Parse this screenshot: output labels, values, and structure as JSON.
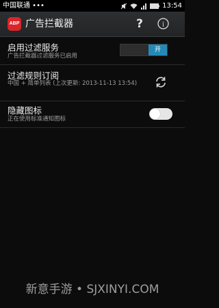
{
  "status_bar": {
    "carrier": "中国联通 ••• ",
    "time": "13:54"
  },
  "app": {
    "icon_text": "ABP",
    "title": "广告拦截器",
    "help_label": "?",
    "info_label": "i"
  },
  "settings": {
    "filtering": {
      "title": "启用过滤服务",
      "summary": "广告拦截器过滤服务已启用",
      "toggle_label": "开",
      "enabled": true
    },
    "subscription": {
      "title": "过滤规则订阅",
      "summary": "中国 + 简单列表 (上次更新: 2013-11-13 13:54)"
    },
    "hide_icon": {
      "title": "隐藏图标",
      "summary": "正在使用标准通知图标",
      "enabled": false
    }
  },
  "watermark": "新意手游 • SJXINYI.COM",
  "colors": {
    "accent": "#2489b7",
    "app_icon": "#d8262b",
    "background": "#0c0c0c"
  }
}
